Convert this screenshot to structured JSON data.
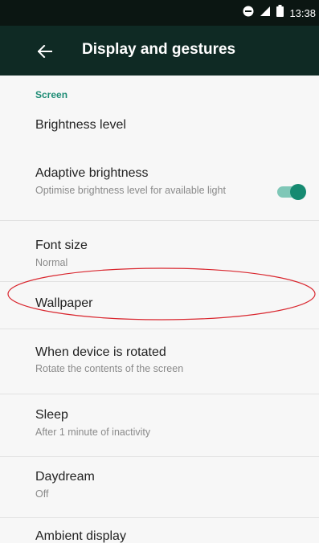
{
  "status_bar": {
    "time": "13:38",
    "icons": [
      "do-not-disturb-icon",
      "signal-icon",
      "battery-icon"
    ]
  },
  "app_bar": {
    "title": "Display and gestures",
    "back_icon": "back-arrow-icon"
  },
  "section": {
    "title": "Screen"
  },
  "settings": {
    "brightness": {
      "title": "Brightness level"
    },
    "adaptive_brightness": {
      "title": "Adaptive brightness",
      "subtitle": "Optimise brightness level for available light",
      "toggle_on": true
    },
    "font_size": {
      "title": "Font size",
      "subtitle": "Normal"
    },
    "wallpaper": {
      "title": "Wallpaper"
    },
    "rotation": {
      "title": "When device is rotated",
      "subtitle": "Rotate the contents of the screen"
    },
    "sleep": {
      "title": "Sleep",
      "subtitle": "After 1 minute of inactivity"
    },
    "daydream": {
      "title": "Daydream",
      "subtitle": "Off"
    },
    "ambient_display": {
      "title": "Ambient display"
    }
  },
  "colors": {
    "accent": "#1e8c75",
    "app_bar": "#0f2a24",
    "status_bar": "#0b1612",
    "annotation": "#d9262e"
  }
}
